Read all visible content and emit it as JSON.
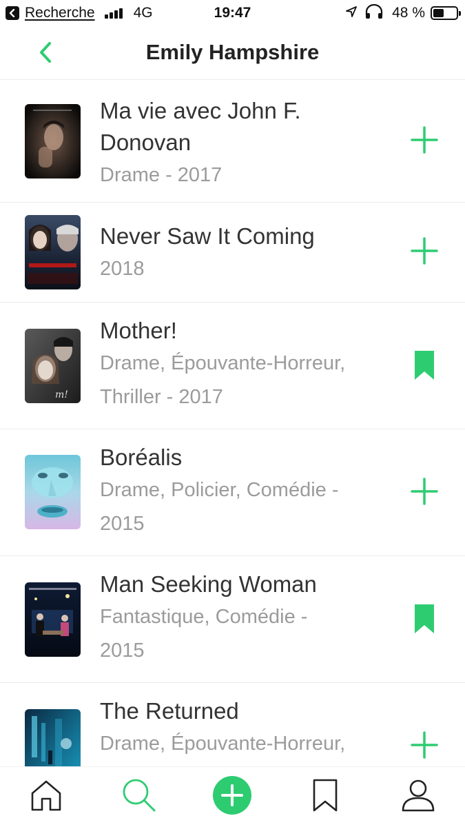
{
  "status_bar": {
    "back_app": "Recherche",
    "network": "4G",
    "time": "19:47",
    "battery": "48 %",
    "battery_level": 0.48
  },
  "nav": {
    "title": "Emily Hampshire",
    "back_icon": "chevron-left-icon"
  },
  "colors": {
    "accent": "#2ecc71",
    "title_text": "#333333",
    "subtitle_text": "#9b9b9b"
  },
  "items": [
    {
      "title_lines": [
        "Ma vie avec John F.",
        "Donovan"
      ],
      "subtitle_lines": [
        "Drame - 2017"
      ],
      "action": "plus-icon"
    },
    {
      "title_lines": [
        "Never Saw It Coming"
      ],
      "subtitle_lines": [
        "2018"
      ],
      "action": "plus-icon"
    },
    {
      "title_lines": [
        "Mother!"
      ],
      "subtitle_lines": [
        "Drame, Épouvante-Horreur,",
        "Thriller - 2017"
      ],
      "action": "bookmark-icon"
    },
    {
      "title_lines": [
        "Boréalis"
      ],
      "subtitle_lines": [
        "Drame, Policier, Comédie -",
        "2015"
      ],
      "action": "plus-icon"
    },
    {
      "title_lines": [
        "Man Seeking Woman"
      ],
      "subtitle_lines": [
        "Fantastique, Comédie -",
        "2015"
      ],
      "action": "bookmark-icon"
    },
    {
      "title_lines": [
        "The Returned"
      ],
      "subtitle_lines": [
        "Drame, Épouvante-Horreur,"
      ],
      "action": "plus-icon"
    }
  ],
  "tab_bar": {
    "tabs": [
      {
        "icon": "home-icon"
      },
      {
        "icon": "search-icon",
        "active": true
      },
      {
        "icon": "add-circle-icon"
      },
      {
        "icon": "bookmark-icon"
      },
      {
        "icon": "profile-icon"
      }
    ]
  }
}
